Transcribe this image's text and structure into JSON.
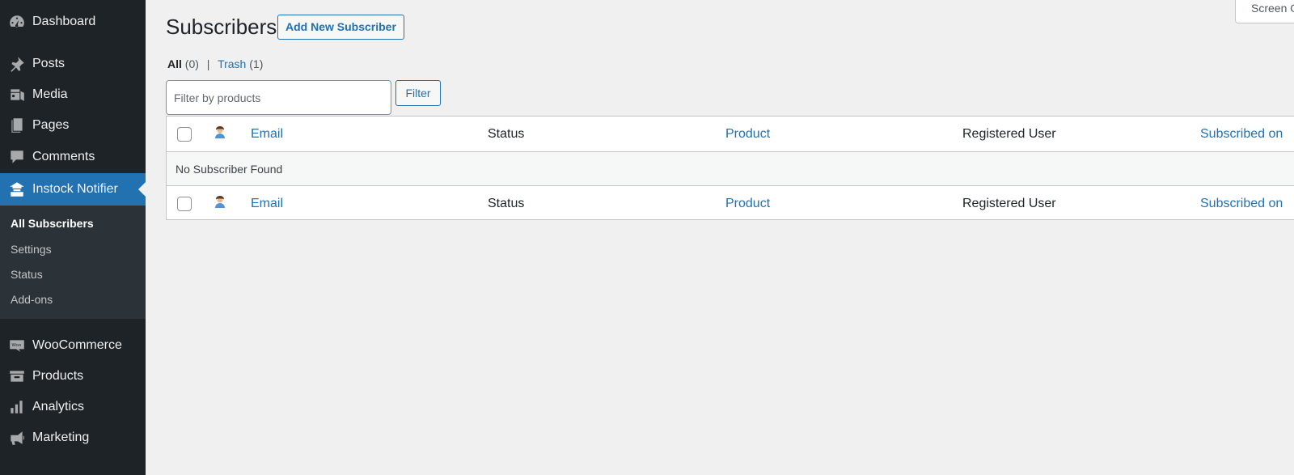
{
  "sidebar": {
    "items": [
      {
        "label": "Dashboard",
        "icon": "dashboard-icon"
      },
      {
        "label": "Posts",
        "icon": "pin-icon"
      },
      {
        "label": "Media",
        "icon": "media-icon"
      },
      {
        "label": "Pages",
        "icon": "pages-icon"
      },
      {
        "label": "Comments",
        "icon": "comment-icon"
      },
      {
        "label": "Instock Notifier",
        "icon": "notifier-icon",
        "active": true
      },
      {
        "label": "WooCommerce",
        "icon": "woo-icon"
      },
      {
        "label": "Products",
        "icon": "archive-icon"
      },
      {
        "label": "Analytics",
        "icon": "bar-chart-icon"
      },
      {
        "label": "Marketing",
        "icon": "megaphone-icon"
      }
    ],
    "submenu": [
      {
        "label": "All Subscribers",
        "current": true
      },
      {
        "label": "Settings"
      },
      {
        "label": "Status"
      },
      {
        "label": "Add-ons"
      }
    ]
  },
  "header": {
    "title": "Subscribers",
    "add_new_label": "Add New Subscriber",
    "screen_options_label": "Screen Options"
  },
  "views": {
    "all_label": "All",
    "all_count": "(0)",
    "separator": "|",
    "trash_label": "Trash",
    "trash_count": "(1)"
  },
  "filter": {
    "placeholder": "Filter by products",
    "value": "",
    "button_label": "Filter"
  },
  "table": {
    "columns": [
      "Email",
      "Status",
      "Product",
      "Registered User",
      "Subscribed on"
    ],
    "empty_message": "No Subscriber Found"
  },
  "colors": {
    "sidebar_bg": "#1d2327",
    "submenu_bg": "#2c3338",
    "accent": "#2271b1",
    "page_bg": "#f0f0f1"
  }
}
